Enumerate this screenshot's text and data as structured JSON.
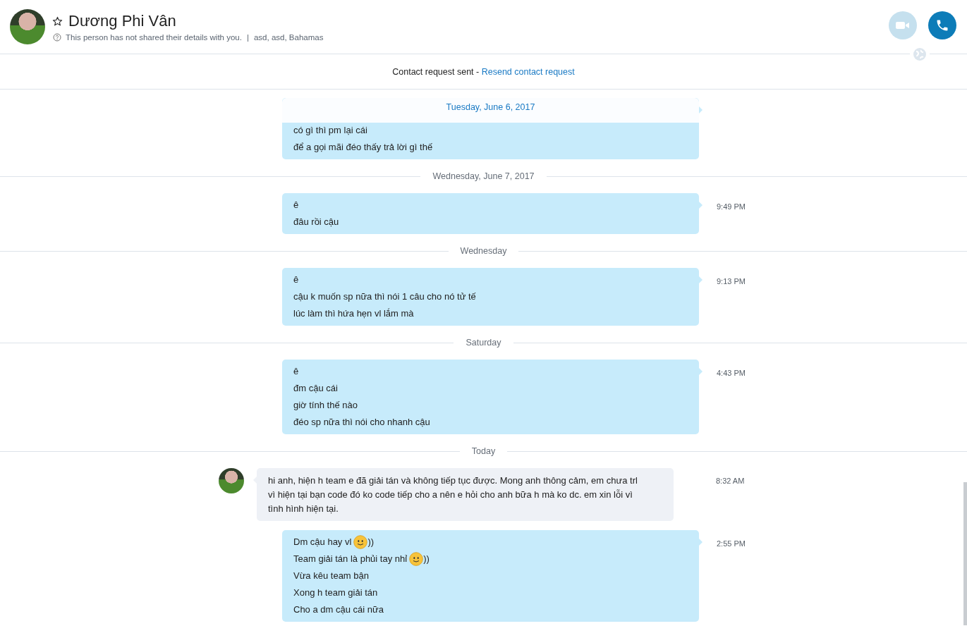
{
  "header": {
    "name": "Dương Phi Vân",
    "details": "This person has not shared their details with you.",
    "separator": "|",
    "location": "asd, asd, Bahamas",
    "favorite": false
  },
  "contact_bar": {
    "text": "Contact request sent - ",
    "link": "Resend contact request"
  },
  "sticky_date": "Tuesday, June 6, 2017",
  "feed": [
    {
      "kind": "sent",
      "lines": [
        {
          "kind": "text",
          "text": "có gì thì pm lại cái"
        },
        {
          "kind": "text",
          "text": "để a gọi mãi đéo thấy trả lời gì thế"
        }
      ]
    },
    {
      "kind": "divider",
      "label": "Wednesday, June 7, 2017"
    },
    {
      "kind": "sent",
      "time": "9:49 PM",
      "lines": [
        {
          "kind": "text",
          "text": "ê"
        },
        {
          "kind": "text",
          "text": "đâu rồi cậu"
        }
      ]
    },
    {
      "kind": "divider",
      "label": "Wednesday"
    },
    {
      "kind": "sent",
      "time": "9:13 PM",
      "lines": [
        {
          "kind": "text",
          "text": "ê"
        },
        {
          "kind": "text",
          "text": "cậu k muốn sp nữa thì nói 1 câu cho nó tử tế"
        },
        {
          "kind": "text",
          "text": "lúc làm thì hứa hẹn vl lắm mà"
        }
      ]
    },
    {
      "kind": "divider",
      "label": "Saturday"
    },
    {
      "kind": "sent",
      "time": "4:43 PM",
      "lines": [
        {
          "kind": "text",
          "text": "ê"
        },
        {
          "kind": "text",
          "text": "đm cậu cái"
        },
        {
          "kind": "text",
          "text": "giờ tính thế nào"
        },
        {
          "kind": "text",
          "text": "đéo sp nữa thì nói cho nhanh cậu"
        }
      ]
    },
    {
      "kind": "divider",
      "label": "Today"
    },
    {
      "kind": "received",
      "time": "8:32 AM",
      "text": "hi anh, hiện h team e đã giải tán và không tiếp tục được. Mong anh thông cảm, em chưa trl vì hiện tại bạn code đó ko code tiếp cho a nên e hỏi cho anh bữa h mà ko dc. em xin lỗi vì tình hình hiện tại."
    },
    {
      "kind": "sent",
      "time": "2:55 PM",
      "lines": [
        {
          "kind": "emoji",
          "text": "Dm cậu hay vl",
          "after": "))"
        },
        {
          "kind": "emoji",
          "text": "Team giải tán là phủi tay nhỉ",
          "after": "))"
        },
        {
          "kind": "text",
          "text": "Vừa kêu team bận"
        },
        {
          "kind": "text",
          "text": "Xong h team giải tán"
        },
        {
          "kind": "text",
          "text": "Cho a dm cậu cái nữa"
        }
      ]
    }
  ]
}
